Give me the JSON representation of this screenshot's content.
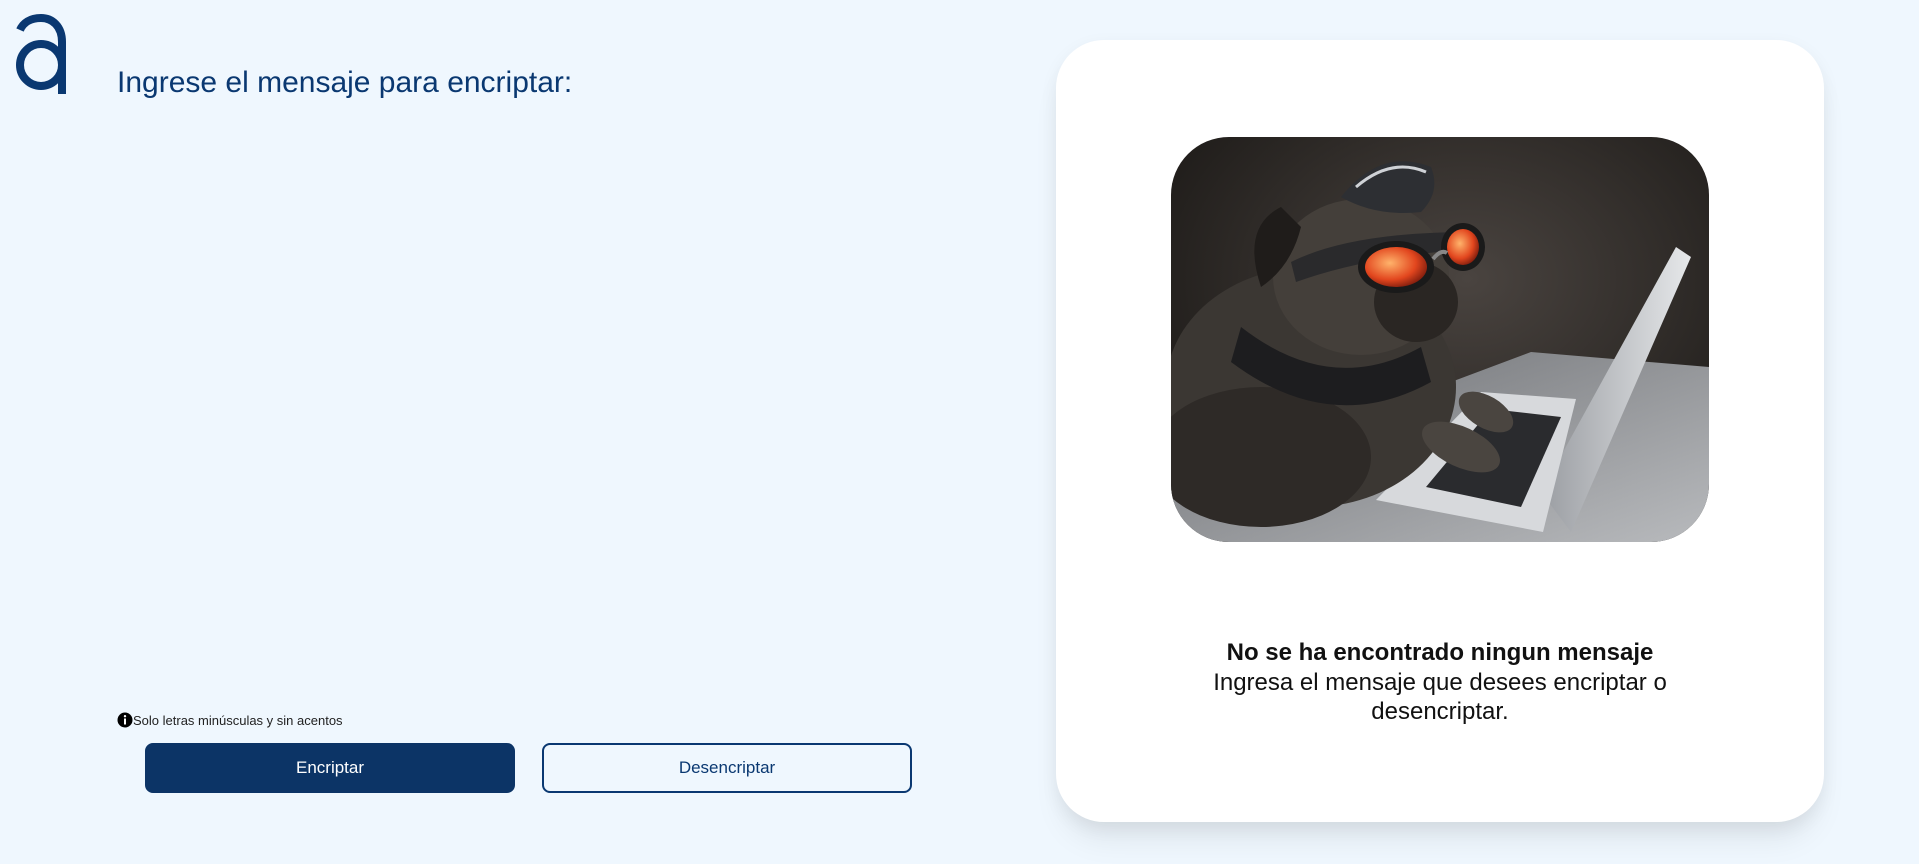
{
  "app": {
    "logo_icon": "alura-logo-icon"
  },
  "input": {
    "placeholder": "Ingrese el mensaje para encriptar:",
    "value": ""
  },
  "hint": {
    "icon": "info-icon",
    "text": "Solo letras minúsculas y sin acentos"
  },
  "actions": {
    "encrypt_label": "Encriptar",
    "decrypt_label": "Desencriptar"
  },
  "output": {
    "image": "pug-hacker-with-laptop",
    "empty_title": "No se ha encontrado ningun mensaje",
    "empty_description": "Ingresa el mensaje que desees encriptar o desencriptar."
  },
  "colors": {
    "background": "#eff7fe",
    "primary": "#0a3871",
    "card": "#ffffff"
  }
}
